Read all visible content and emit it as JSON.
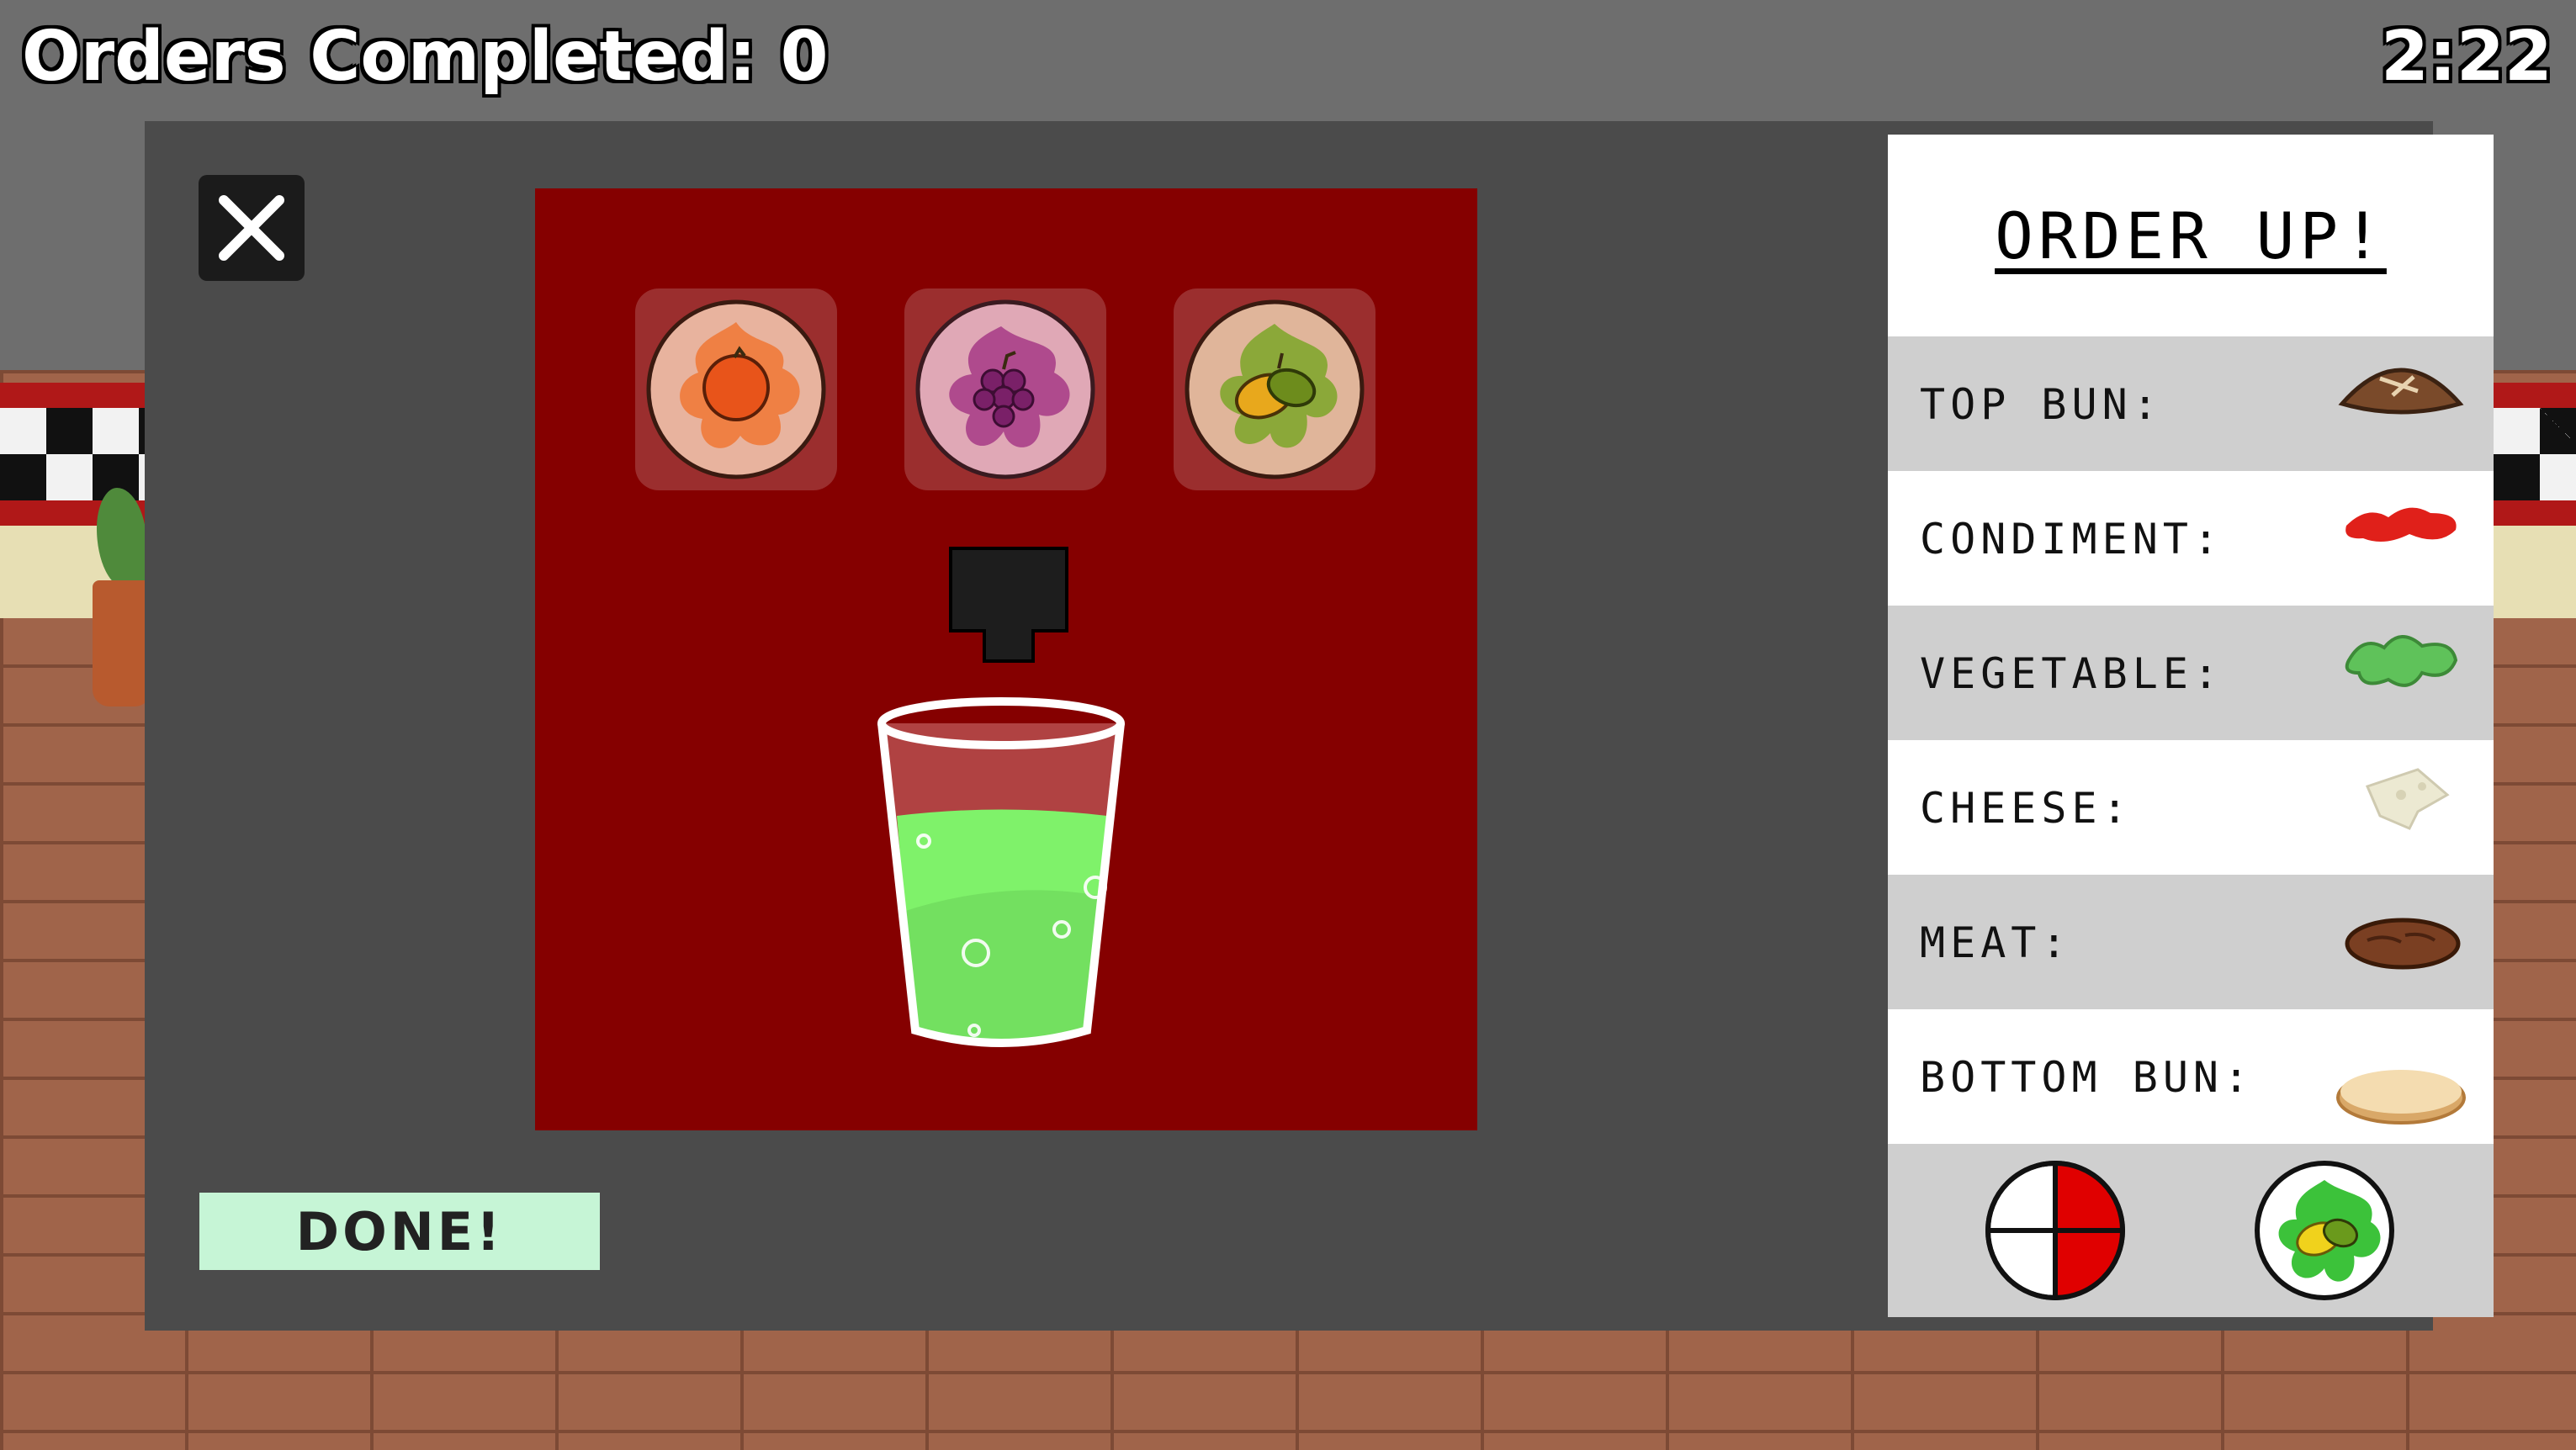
{
  "hud": {
    "orders_completed_label": "Orders Completed: 0",
    "timer": "2:22"
  },
  "drink_station": {
    "close_icon": "close-icon",
    "fruits": [
      {
        "name": "orange",
        "icon": "orange-splash-icon",
        "color": "#e8541a"
      },
      {
        "name": "grape",
        "icon": "grape-splash-icon",
        "color": "#8e2a6b"
      },
      {
        "name": "lemon-lime",
        "icon": "lemon-lime-splash-icon",
        "color": "#6f9a1f"
      }
    ],
    "cup_fill_color": "#7ff26a",
    "done_label": "DONE!"
  },
  "order": {
    "title": "ORDER UP!",
    "rows": [
      {
        "label": "TOP BUN:",
        "icon": "top-bun-icon"
      },
      {
        "label": "CONDIMENT:",
        "icon": "ketchup-icon"
      },
      {
        "label": "VEGETABLE:",
        "icon": "lettuce-icon"
      },
      {
        "label": "CHEESE:",
        "icon": "cheese-icon"
      },
      {
        "label": "MEAT:",
        "icon": "patty-icon"
      },
      {
        "label": "BOTTOM BUN:",
        "icon": "bottom-bun-icon"
      }
    ],
    "footer": {
      "side_icon": "fries-quarter-icon",
      "drink_icon": "lemon-lime-drink-icon"
    }
  }
}
